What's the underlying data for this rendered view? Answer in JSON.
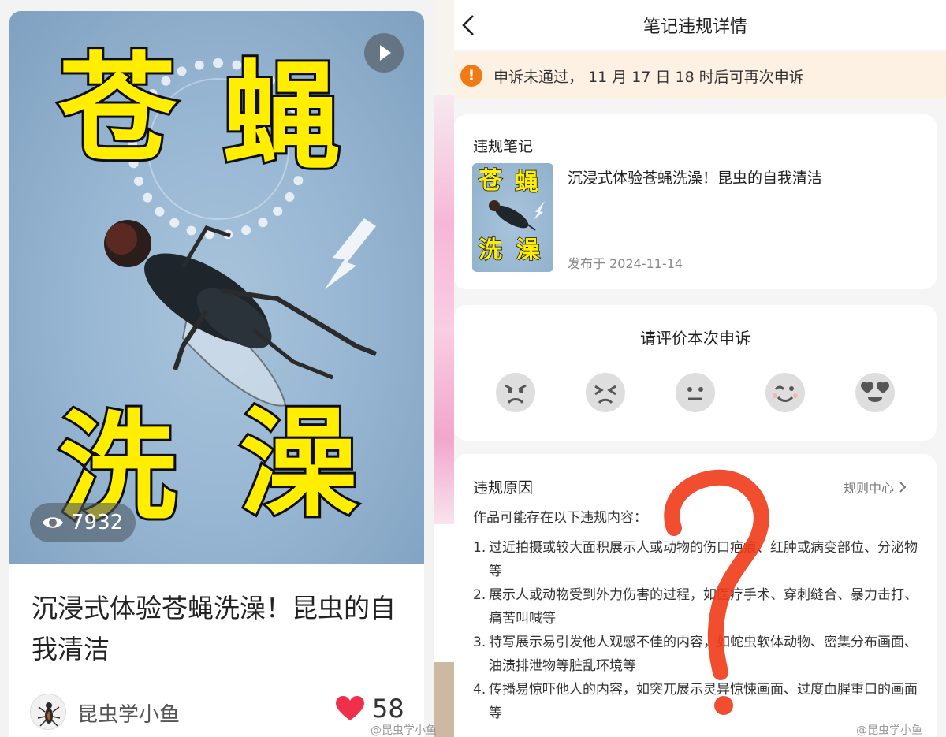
{
  "left_panel": {
    "cover_text": [
      "苍",
      "蝇",
      "洗",
      "澡"
    ],
    "view_count": "7932",
    "title": "沉浸式体验苍蝇洗澡！昆虫的自我清洁",
    "author": "昆虫学小鱼",
    "like_count": "58",
    "like_color": "#f0304a",
    "cover_text_color": "#ffee00"
  },
  "right_panel": {
    "nav": {
      "title": "笔记违规详情"
    },
    "notice": {
      "icon": "!",
      "text": "申诉未通过， 11 月 17 日 18 时后可再次申诉",
      "icon_color": "#f07a16"
    },
    "violating_note": {
      "heading": "违规笔记",
      "thumb_text": [
        "苍",
        "蝇",
        "洗",
        "澡"
      ],
      "title": "沉浸式体验苍蝇洗澡！昆虫的自我清洁",
      "published": "发布于 2024-11-14"
    },
    "evaluation": {
      "title": "请评价本次申诉",
      "faces": [
        "angry-face-icon",
        "frustrated-face-icon",
        "neutral-face-icon",
        "smiling-face-icon",
        "heart-eyes-face-icon"
      ]
    },
    "reason": {
      "heading": "违规原因",
      "rules_link": "规则中心",
      "intro": "作品可能存在以下违规内容：",
      "items": [
        {
          "num": "1.",
          "text": "过近拍摄或较大面积展示人或动物的伤口疤痕、红肿或病变部位、分泌物等"
        },
        {
          "num": "2.",
          "text": "展示人或动物受到外力伤害的过程，如医疗手术、穿刺缝合、暴力击打、痛苦叫喊等"
        },
        {
          "num": "3.",
          "text": "特写展示易引发他人观感不佳的内容，如蛇虫软体动物、密集分布画面、油渍排泄物等脏乱环境等"
        },
        {
          "num": "4.",
          "text": "传播易惊吓他人的内容，如突兀展示灵异惊悚画面、过度血腥重口的画面等"
        }
      ]
    }
  },
  "watermarks": [
    "@昆虫学小鱼",
    "@昆虫学小鱼"
  ]
}
